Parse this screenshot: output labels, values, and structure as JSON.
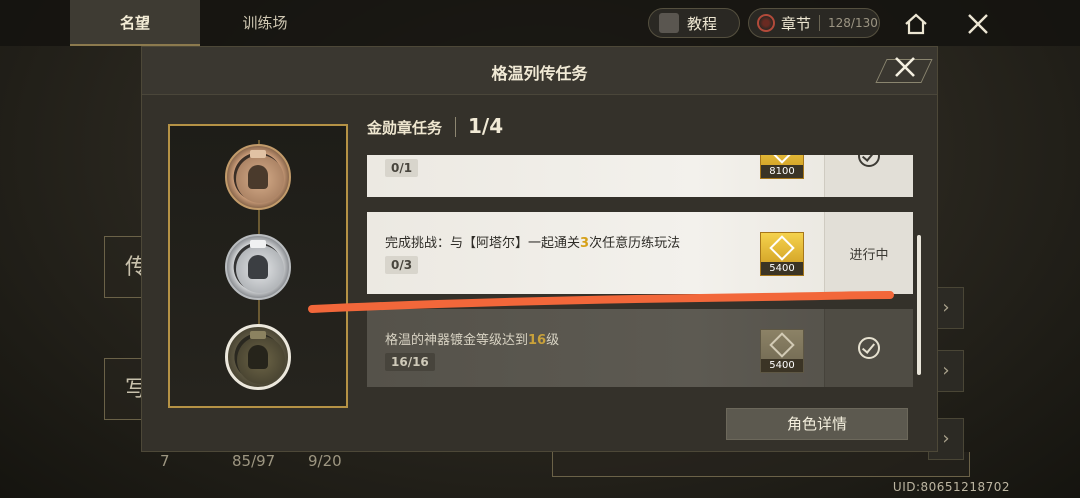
{
  "topbar": {
    "tabs": [
      "名望",
      "训练场"
    ],
    "tutorial_label": "教程",
    "chapter_label": "章节",
    "chapter_count": "128/130"
  },
  "background": {
    "left_glyph_1": "传",
    "left_glyph_2": "写",
    "stats": [
      "7",
      "85/97",
      "9/20"
    ],
    "uid": "UID:80651218702"
  },
  "modal": {
    "title": "格温列传任务",
    "section_title": "金勋章任务",
    "section_count": "1/4",
    "tasks": [
      {
        "desc": "",
        "progress": "0/1",
        "reward": "8100",
        "status": "check",
        "state": "active"
      },
      {
        "desc_pre": "完成挑战：与【阿塔尔】一起通关",
        "desc_hl": "3",
        "desc_post": "次任意历练玩法",
        "progress": "0/3",
        "reward": "5400",
        "status": "进行中",
        "state": "active"
      },
      {
        "desc_pre": "格温的神器镀金等级达到",
        "desc_hl": "16",
        "desc_post": "级",
        "progress": "16/16",
        "reward": "5400",
        "status": "check",
        "state": "done"
      }
    ],
    "detail_button": "角色详情",
    "medals": [
      "bronze",
      "silver",
      "gold"
    ]
  },
  "colors": {
    "accent_gold": "#d6a019",
    "annotation_stroke": "#f2673a"
  }
}
